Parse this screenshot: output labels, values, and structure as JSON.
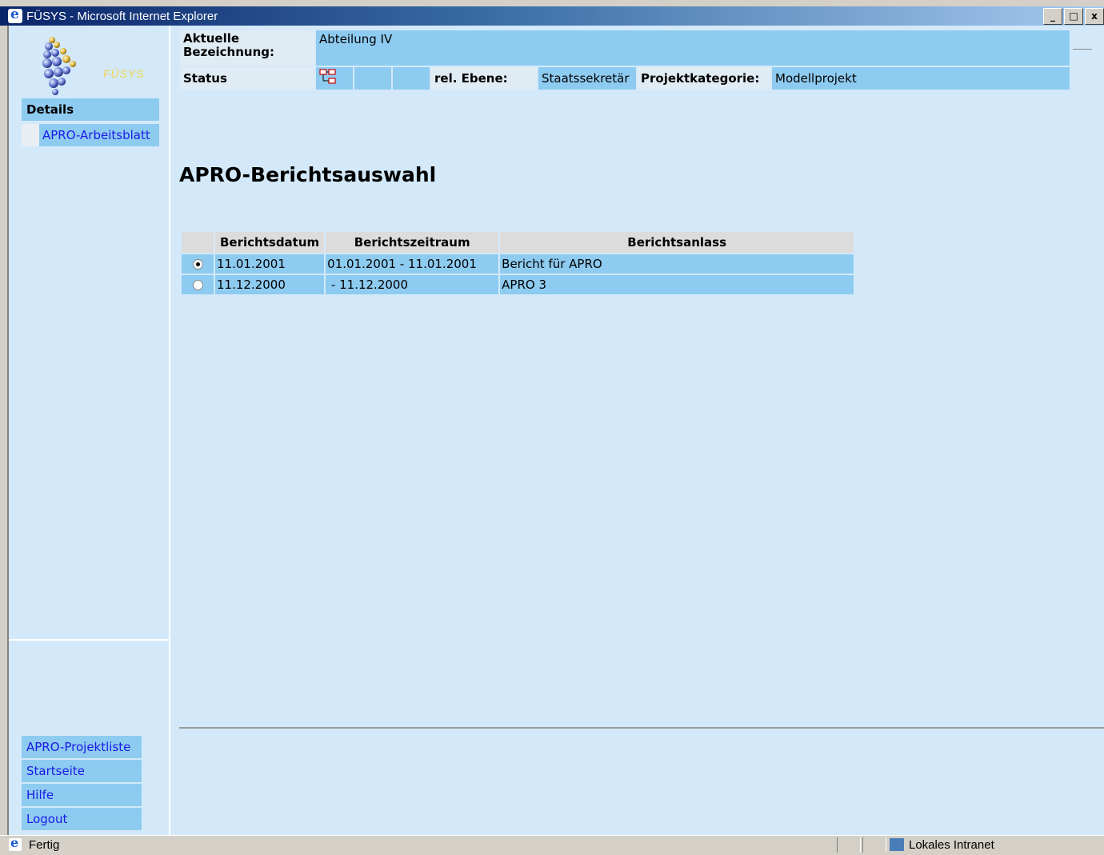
{
  "window": {
    "title": "FÜSYS - Microsoft Internet Explorer",
    "buttons": [
      "_",
      "□",
      "x"
    ]
  },
  "logo": {
    "text": "FÜSYS"
  },
  "nav": {
    "section": "Details",
    "sub_items": [
      "APRO-Arbeitsblatt"
    ],
    "bottom_links": [
      "APRO-Projektliste",
      "Startseite",
      "Hilfe",
      "Logout"
    ]
  },
  "header": {
    "bezeichnung_label": "Aktuelle Bezeichnung:",
    "bezeichnung_value": "Abteilung IV",
    "status_label": "Status",
    "status_icon": "hierarchy-icon",
    "ebene_label": "rel. Ebene:",
    "ebene_value": "Staatssekretär",
    "kategorie_label": "Projektkategorie:",
    "kategorie_value": "Modellprojekt"
  },
  "main": {
    "title": "APRO-Berichtsauswahl",
    "columns": [
      "",
      "Berichtsdatum",
      "Berichtszeitraum",
      "Berichtsanlass"
    ],
    "rows": [
      {
        "selected": true,
        "datum": "11.01.2001",
        "zeitraum": "01.01.2001 - 11.01.2001",
        "anlass": "Bericht für APRO"
      },
      {
        "selected": false,
        "datum": "11.12.2000",
        "zeitraum": " - 11.12.2000",
        "anlass": "APRO 3"
      }
    ]
  },
  "statusbar": {
    "text": "Fertig",
    "zone": "Lokales Intranet"
  },
  "colors": {
    "background": "#d3e9f9",
    "cell": "#8ecbf0",
    "header_cell": "#dcdcdc",
    "link": "#1a1ae6"
  }
}
